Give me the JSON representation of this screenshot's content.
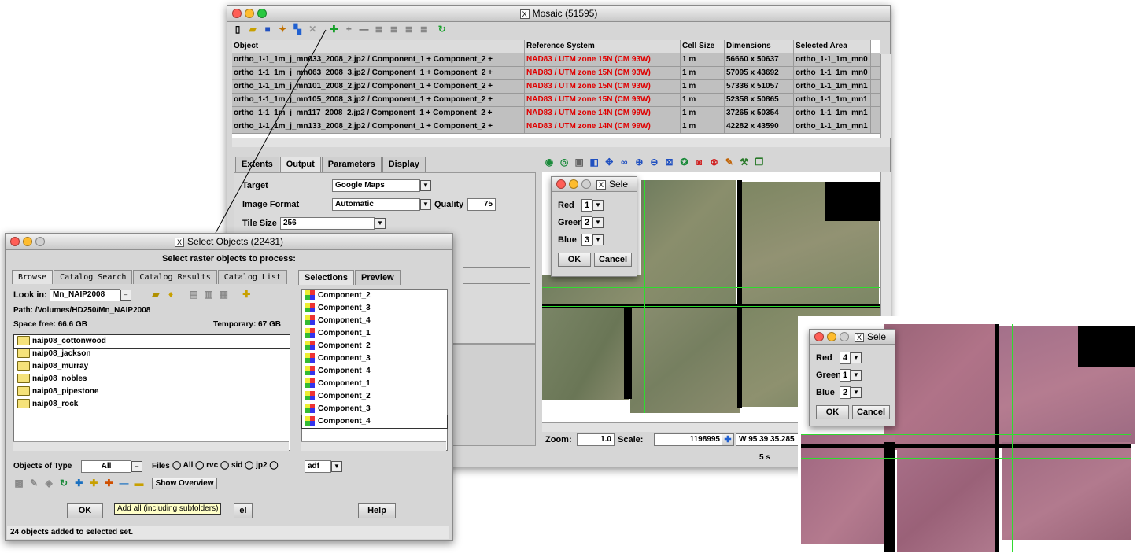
{
  "mosaic": {
    "title": "Mosaic (51595)",
    "columns": [
      "Object",
      "Reference System",
      "Cell Size",
      "Dimensions",
      "Selected Area"
    ],
    "rows": [
      {
        "object": "ortho_1-1_1m_j_mn033_2008_2.jp2 / Component_1 + Component_2 +",
        "ref": "NAD83 / UTM zone 15N (CM 93W)",
        "cell": "1 m",
        "dims": "56660 x 50637",
        "area": "ortho_1-1_1m_mn0"
      },
      {
        "object": "ortho_1-1_1m_j_mn063_2008_3.jp2 / Component_1 + Component_2 +",
        "ref": "NAD83 / UTM zone 15N (CM 93W)",
        "cell": "1 m",
        "dims": "57095 x 43692",
        "area": "ortho_1-1_1m_mn0"
      },
      {
        "object": "ortho_1-1_1m_j_mn101_2008_2.jp2 / Component_1 + Component_2 +",
        "ref": "NAD83 / UTM zone 15N (CM 93W)",
        "cell": "1 m",
        "dims": "57336 x 51057",
        "area": "ortho_1-1_1m_mn1"
      },
      {
        "object": "ortho_1-1_1m_j_mn105_2008_3.jp2 / Component_1 + Component_2 +",
        "ref": "NAD83 / UTM zone 15N (CM 93W)",
        "cell": "1 m",
        "dims": "52358 x 50865",
        "area": "ortho_1-1_1m_mn1"
      },
      {
        "object": "ortho_1-1_1m_j_mn117_2008_2.jp2 / Component_1 + Component_2 +",
        "ref": "NAD83 / UTM zone 14N (CM 99W)",
        "cell": "1 m",
        "dims": "37265 x 50354",
        "area": "ortho_1-1_1m_mn1"
      },
      {
        "object": "ortho_1-1_1m_j_mn133_2008_2.jp2 / Component_1 + Component_2 +",
        "ref": "NAD83 / UTM zone 14N (CM 99W)",
        "cell": "1 m",
        "dims": "42282 x 43590",
        "area": "ortho_1-1_1m_mn1"
      }
    ],
    "tabs": [
      "Extents",
      "Output",
      "Parameters",
      "Display"
    ],
    "target_label": "Target",
    "target_value": "Google Maps",
    "image_format_label": "Image Format",
    "image_format_value": "Automatic",
    "quality_label": "Quality",
    "quality_value": "75",
    "tile_size_label": "Tile Size",
    "tile_size_value": "256",
    "zoom_label": "Zoom:",
    "zoom_value": "1.0",
    "scale_label": "Scale:",
    "scale_value": "1198995",
    "coords": "W 95 39 35.285",
    "status_time": "5 s"
  },
  "rgb_dialog_1": {
    "title": "Sele",
    "red_label": "Red",
    "red": "1",
    "green_label": "Green",
    "green": "2",
    "blue_label": "Blue",
    "blue": "3",
    "ok": "OK",
    "cancel": "Cancel"
  },
  "rgb_dialog_2": {
    "title": "Sele",
    "red_label": "Red",
    "red": "4",
    "green_label": "Green",
    "green": "1",
    "blue_label": "Blue",
    "blue": "2",
    "ok": "OK",
    "cancel": "Cancel"
  },
  "select": {
    "title": "Select Objects (22431)",
    "heading": "Select raster objects to process:",
    "tabs": [
      "Browse",
      "Catalog Search",
      "Catalog Results",
      "Catalog List"
    ],
    "right_tabs": [
      "Selections",
      "Preview"
    ],
    "look_in_label": "Look in:",
    "look_in_value": "Mn_NAIP2008",
    "path": "Path: /Volumes/HD250/Mn_NAIP2008",
    "space_free": "Space free:  66.6 GB",
    "temporary": "Temporary: 67 GB",
    "folders": [
      "naip08_cottonwood",
      "naip08_jackson",
      "naip08_murray",
      "naip08_nobles",
      "naip08_pipestone",
      "naip08_rock"
    ],
    "components": [
      "Component_2",
      "Component_3",
      "Component_4",
      "Component_1",
      "Component_2",
      "Component_3",
      "Component_4",
      "Component_1",
      "Component_2",
      "Component_3",
      "Component_4"
    ],
    "objects_of_type_label": "Objects of Type",
    "objects_of_type_value": "All",
    "files_label": "Files",
    "file_opts": [
      "All",
      "rvc",
      "sid",
      "jp2"
    ],
    "adf": "adf",
    "show_overview": "Show Overview",
    "ok": "OK",
    "cancel_partial": "el",
    "help": "Help",
    "tooltip": "Add all (including subfolders)",
    "status": "24 objects added to selected set."
  },
  "colors": {
    "traffic_red": "#ff5f57",
    "traffic_yellow": "#febc2e",
    "ref_red": "#e00000",
    "grid_green": "#2fdc2f"
  }
}
